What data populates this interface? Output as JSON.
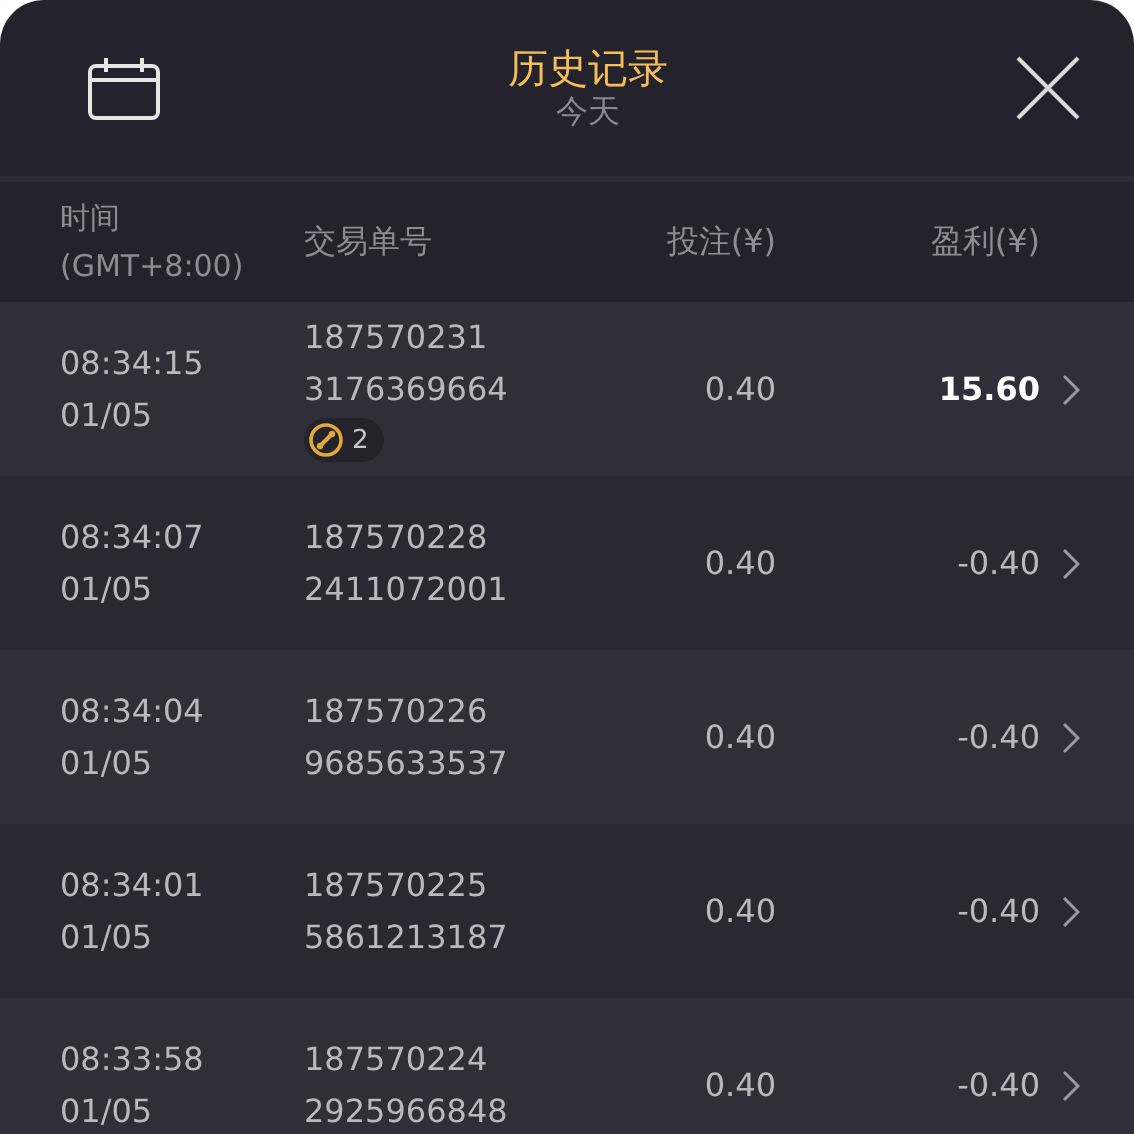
{
  "header": {
    "title": "历史记录",
    "subtitle": "今天"
  },
  "table": {
    "columns": [
      {
        "label": "时间\n(GMT+8:00)"
      },
      {
        "label": "交易单号"
      },
      {
        "label": "投注(¥)"
      },
      {
        "label": "盈利(¥)"
      }
    ],
    "rows": [
      {
        "time": "08:34:15",
        "date": "01/05",
        "id_1": "187570231",
        "id_2": "3176369664",
        "badge": "2",
        "bet": "0.40",
        "profit": "15.60",
        "win": true
      },
      {
        "time": "08:34:07",
        "date": "01/05",
        "id_1": "187570228",
        "id_2": "2411072001",
        "bet": "0.40",
        "profit": "-0.40",
        "win": false
      },
      {
        "time": "08:34:04",
        "date": "01/05",
        "id_1": "187570226",
        "id_2": "9685633537",
        "bet": "0.40",
        "profit": "-0.40",
        "win": false
      },
      {
        "time": "08:34:01",
        "date": "01/05",
        "id_1": "187570225",
        "id_2": "5861213187",
        "bet": "0.40",
        "profit": "-0.40",
        "win": false
      },
      {
        "time": "08:33:58",
        "date": "01/05",
        "id_1": "187570224",
        "id_2": "2925966848",
        "bet": "0.40",
        "profit": "-0.40",
        "win": false
      }
    ]
  }
}
